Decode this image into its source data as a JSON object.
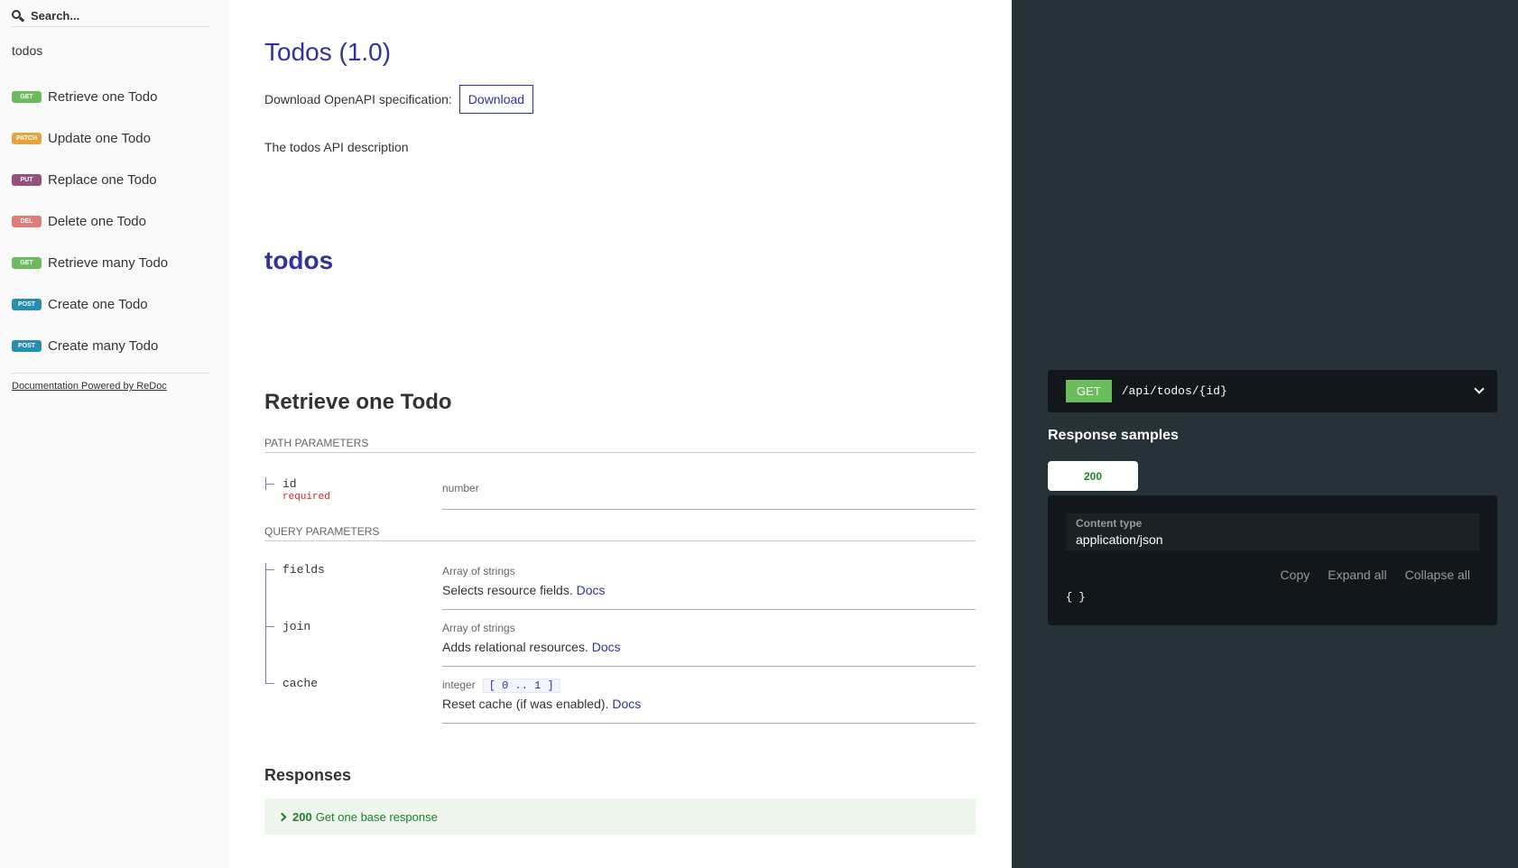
{
  "sidebar": {
    "search_placeholder": "Search...",
    "section": "todos",
    "items": [
      {
        "method": "GET",
        "label": "Retrieve one Todo",
        "color": "#6bbd5b"
      },
      {
        "method": "PATCH",
        "label": "Update one Todo",
        "color": "#e5a43b"
      },
      {
        "method": "PUT",
        "label": "Replace one Todo",
        "color": "#95507c"
      },
      {
        "method": "DEL",
        "label": "Delete one Todo",
        "color": "#e27a7a"
      },
      {
        "method": "GET",
        "label": "Retrieve many Todo",
        "color": "#6bbd5b"
      },
      {
        "method": "POST",
        "label": "Create one Todo",
        "color": "#248fb2"
      },
      {
        "method": "POST",
        "label": "Create many Todo",
        "color": "#248fb2"
      }
    ],
    "powered_by": "Documentation Powered by ReDoc"
  },
  "main": {
    "title": "Todos (1.0)",
    "download_label": "Download OpenAPI specification:",
    "download_button": "Download",
    "description": "The todos API description",
    "tag": "todos",
    "operation": {
      "title": "Retrieve one Todo",
      "path_params_label": "PATH PARAMETERS",
      "path_params": [
        {
          "name": "id",
          "required": "required",
          "type": "number"
        }
      ],
      "query_params_label": "QUERY PARAMETERS",
      "query_params": [
        {
          "name": "fields",
          "type": "Array of strings",
          "description": "Selects resource fields.",
          "link": "Docs"
        },
        {
          "name": "join",
          "type": "Array of strings",
          "description": "Adds relational resources.",
          "link": "Docs"
        },
        {
          "name": "cache",
          "type": "integer",
          "range": "[ 0 .. 1 ]",
          "description": "Reset cache (if was enabled).",
          "link": "Docs"
        }
      ],
      "responses_label": "Responses",
      "response": {
        "code": "200",
        "text": "Get one base response"
      }
    }
  },
  "right": {
    "method": "GET",
    "path": "/api/todos/{id}",
    "samples_title": "Response samples",
    "status_tab": "200",
    "content_type_label": "Content type",
    "content_type": "application/json",
    "actions": {
      "copy": "Copy",
      "expand": "Expand all",
      "collapse": "Collapse all"
    },
    "json_body": "{ }"
  },
  "colors": {
    "accent": "#32329f",
    "right_bg": "#263238",
    "get": "#6bbd5b",
    "success": "#1d8127",
    "required": "#d41f1c"
  }
}
